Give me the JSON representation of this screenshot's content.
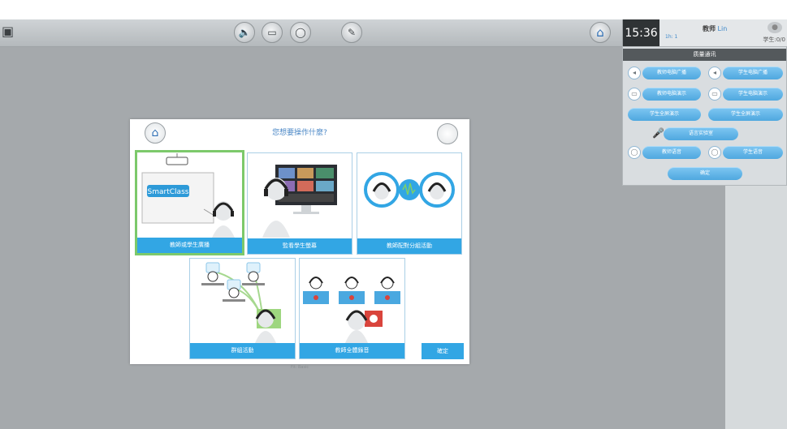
{
  "toolbar": {
    "left_icon": "computer-icon",
    "center_icons": [
      "speaker-icon",
      "monitor-icon",
      "chat-icon",
      "pen-icon"
    ],
    "home_icon": "home-icon"
  },
  "status": {
    "time": "15:36",
    "sub": "1h: 1",
    "teacher_prefix": "教师",
    "teacher_name": "Lin",
    "student": "学生:0/0"
  },
  "panel": {
    "title": "质量通讯",
    "buttons": [
      "教师电脑广播",
      "学生电脑广播",
      "教师电脑演示",
      "学生电脑演示",
      "学生全屏演示",
      "学生全屏演示",
      "语言实验室",
      "教师语音",
      "学生语音",
      "确定"
    ]
  },
  "dialog": {
    "title": "您想要操作什麼?",
    "cards": [
      {
        "label": "教師或學生廣播",
        "selected": true
      },
      {
        "label": "監看學生螢幕",
        "selected": false
      },
      {
        "label": "教師配對分組活動",
        "selected": false
      },
      {
        "label": "群組活動",
        "selected": false
      },
      {
        "label": "教師全體錄音",
        "selected": false
      }
    ],
    "smartclass_text": "SmartClass",
    "ok_label": "確定",
    "footer": "Fit: Basic"
  },
  "colors": {
    "accent": "#32a6e4",
    "selected_border": "#7cc96b",
    "background": "#a5a9ac"
  }
}
